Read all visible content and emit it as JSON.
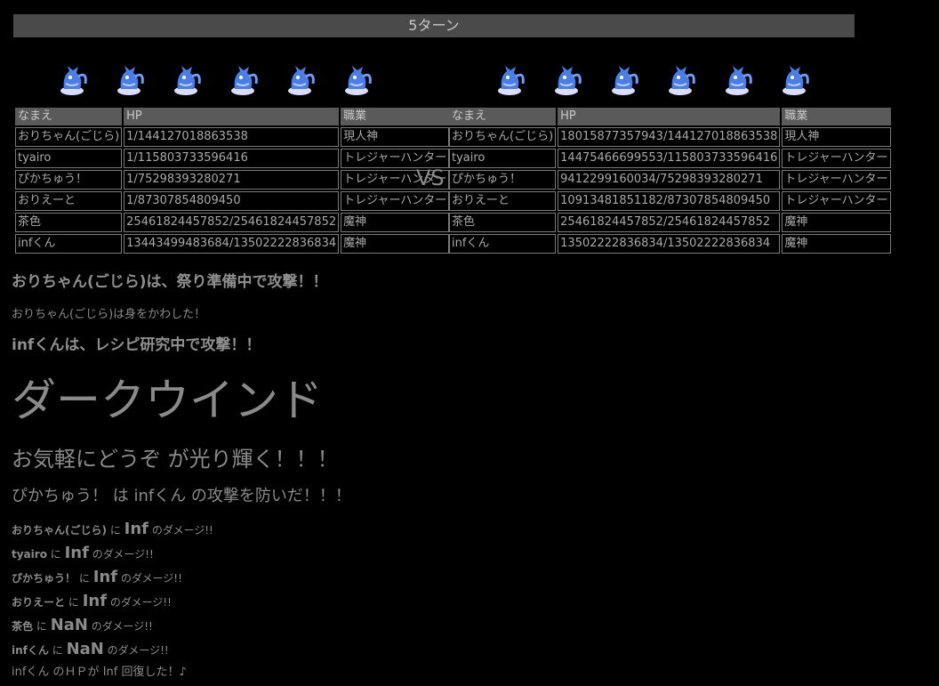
{
  "turn": {
    "label": "5ターン"
  },
  "headers": {
    "name": "なまえ",
    "hp": "HP",
    "job": "職業"
  },
  "vs": "VS",
  "left_team": [
    {
      "name": "おりちゃん(ごじら)",
      "hp": "1/144127018863538",
      "job": "現人神"
    },
    {
      "name": "tyairo",
      "hp": "1/115803733596416",
      "job": "トレジャーハンター"
    },
    {
      "name": "ぴかちゅう！",
      "hp": "1/75298393280271",
      "job": "トレジャーハンター"
    },
    {
      "name": "おりえーと",
      "hp": "1/87307854809450",
      "job": "トレジャーハンター"
    },
    {
      "name": "茶色",
      "hp": "25461824457852/25461824457852",
      "job": "魔神"
    },
    {
      "name": "infくん",
      "hp": "13443499483684/13502222836834",
      "job": "魔神"
    }
  ],
  "right_team": [
    {
      "name": "おりちゃん(ごじら)",
      "hp": "18015877357943/144127018863538",
      "job": "現人神"
    },
    {
      "name": "tyairo",
      "hp": "14475466699553/115803733596416",
      "job": "トレジャーハンター"
    },
    {
      "name": "ぴかちゅう！",
      "hp": "9412299160034/75298393280271",
      "job": "トレジャーハンター"
    },
    {
      "name": "おりえーと",
      "hp": "10913481851182/87307854809450",
      "job": "トレジャーハンター"
    },
    {
      "name": "茶色",
      "hp": "25461824457852/25461824457852",
      "job": "魔神"
    },
    {
      "name": "infくん",
      "hp": "13502222836834/13502222836834",
      "job": "魔神"
    }
  ],
  "log": {
    "attack1": "おりちゃん(ごじら)は、祭り準備中で攻撃！！",
    "dodge": "おりちゃん(ごじら)は身をかわした！",
    "attack2": "infくんは、レシピ研究中で攻撃！！",
    "skill": "ダークウインド",
    "shine": "お気軽にどうぞ が光り輝く！！！",
    "guard": "ぴかちゅう！ は infくん の攻撃を防いだ！！！",
    "damage_connector": "に",
    "damage_suffix": "のダメージ!!",
    "damage": [
      {
        "target": "おりちゃん(ごじら)",
        "amount": "Inf"
      },
      {
        "target": "tyairo",
        "amount": "Inf"
      },
      {
        "target": "ぴかちゅう！",
        "amount": "Inf"
      },
      {
        "target": "おりえーと",
        "amount": "Inf"
      },
      {
        "target": "茶色",
        "amount": "NaN"
      },
      {
        "target": "infくん",
        "amount": "NaN"
      }
    ],
    "heal": "infくん のＨＰが Inf 回復した！♪"
  }
}
